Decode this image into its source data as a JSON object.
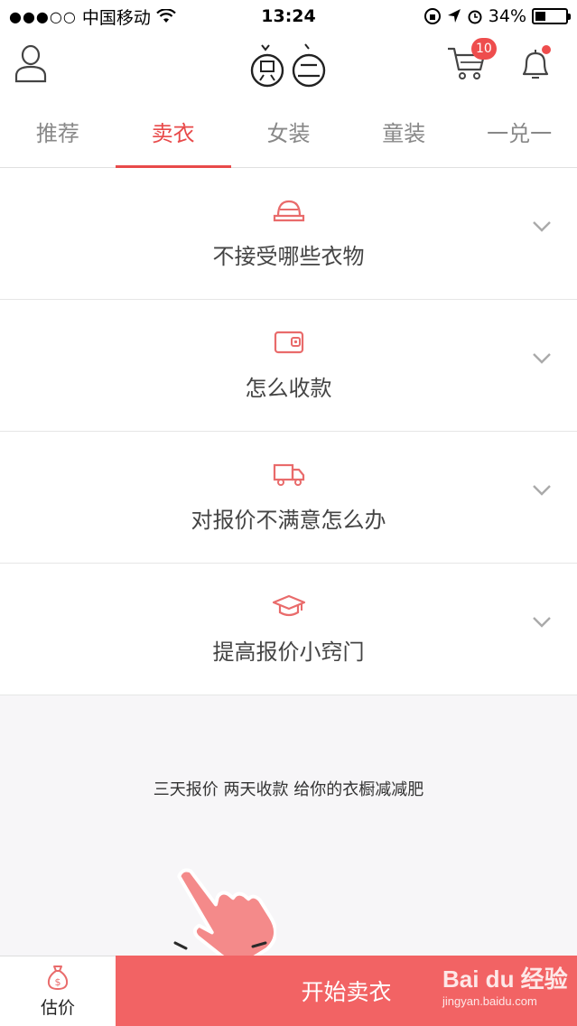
{
  "status_bar": {
    "carrier": "中国移动",
    "time": "13:24",
    "battery": "34%",
    "battery_level": 0.34
  },
  "header": {
    "cart_badge": "10",
    "icons": [
      "user-icon",
      "logo-icon",
      "cart-icon",
      "bell-icon"
    ]
  },
  "tabs": [
    {
      "label": "推荐",
      "active": false
    },
    {
      "label": "卖衣",
      "active": true
    },
    {
      "label": "女装",
      "active": false
    },
    {
      "label": "童装",
      "active": false
    },
    {
      "label": "一兑一",
      "active": false
    }
  ],
  "accordion": [
    {
      "label": "不接受哪些衣物",
      "icon": "hat-icon"
    },
    {
      "label": "怎么收款",
      "icon": "wallet-icon"
    },
    {
      "label": "对报价不满意怎么办",
      "icon": "truck-icon"
    },
    {
      "label": "提高报价小窍门",
      "icon": "graduation-cap-icon"
    }
  ],
  "slogan": "三天报价 两天收款 给你的衣橱减减肥",
  "bottom": {
    "estimate_label": "估价",
    "start_label": "开始卖衣"
  },
  "watermark": {
    "main": "Bai du 经验",
    "sub": "jingyan.baidu.com"
  },
  "colors": {
    "accent": "#e84a4a",
    "button": "#f26364"
  }
}
